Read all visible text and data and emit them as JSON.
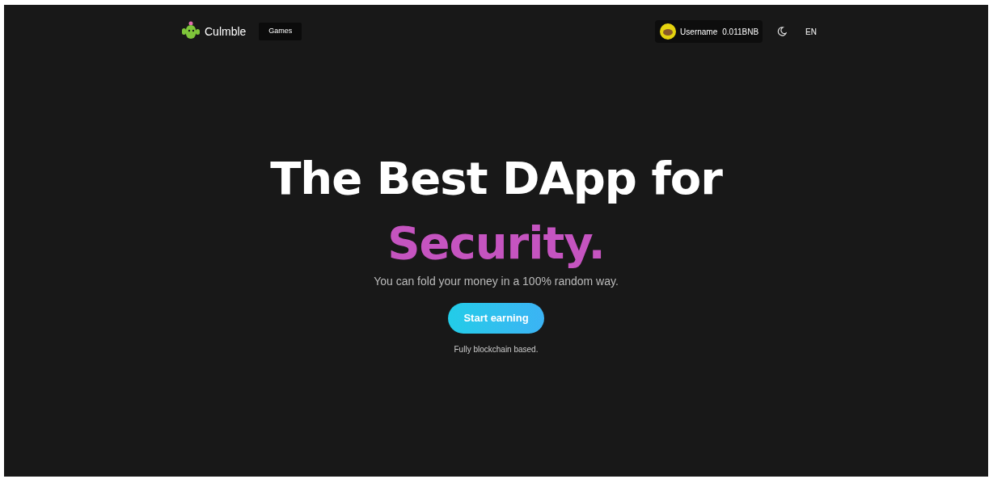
{
  "nav": {
    "brand": "Culmble",
    "links": [
      "Games"
    ],
    "account": {
      "username": "Username",
      "balance": "0.011BNB"
    },
    "language": "EN"
  },
  "hero": {
    "title": "The Best DApp for",
    "highlight": "Security.",
    "subtitle": "You can fold your money in a 100% random way.",
    "button": "Start earning",
    "note": "Fully blockchain based."
  }
}
